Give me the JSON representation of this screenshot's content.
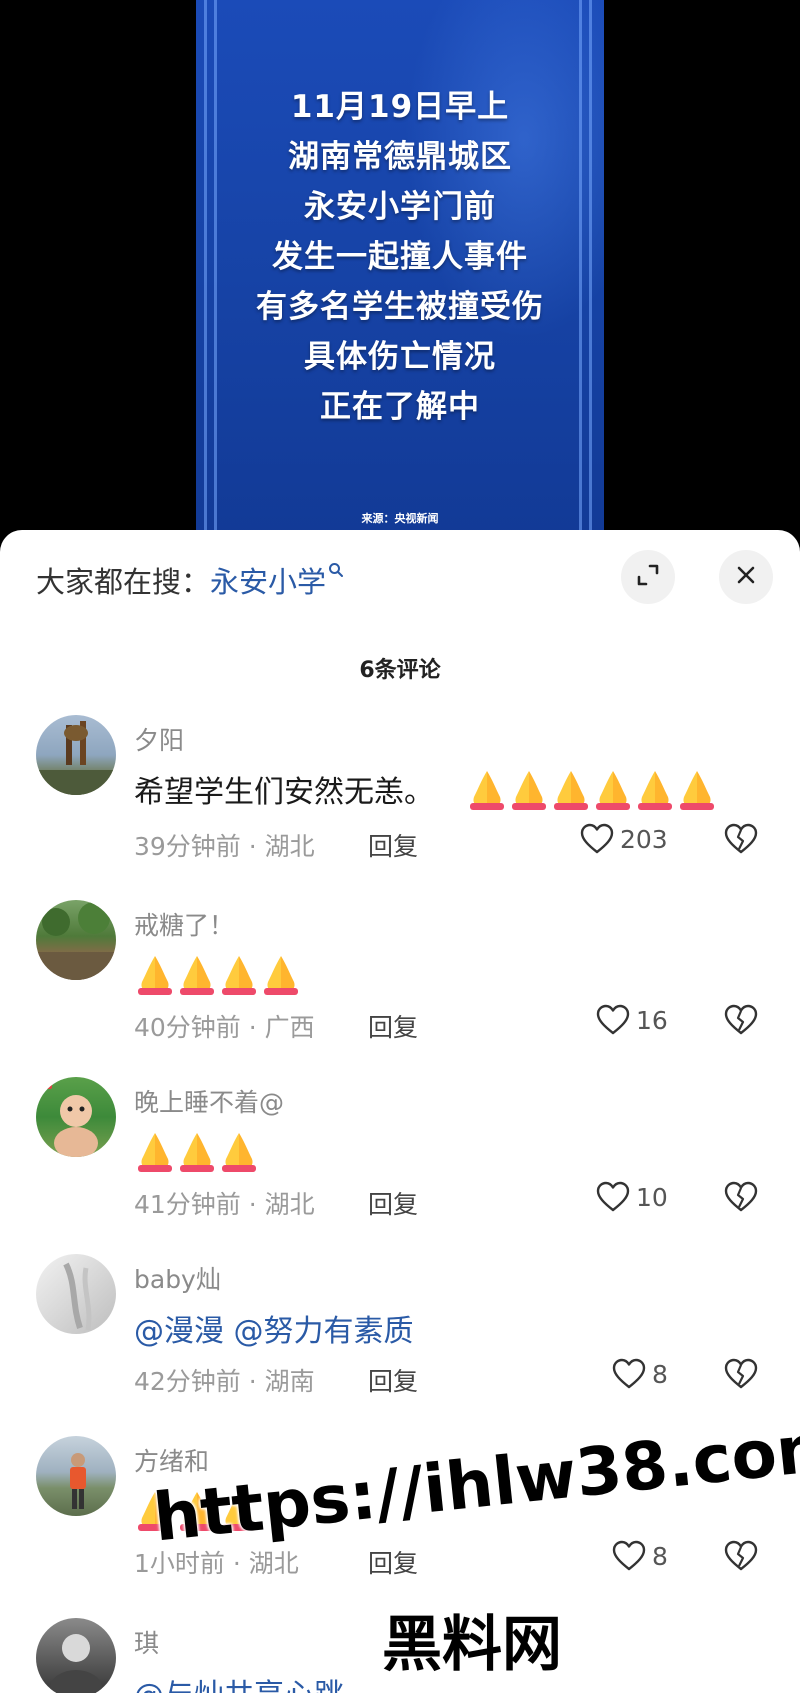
{
  "video": {
    "headline_lines": [
      "11月19日早上",
      "湖南常德鼎城区",
      "永安小学门前",
      "发生一起撞人事件",
      "有多名学生被撞受伤",
      "具体伤亡情况",
      "正在了解中"
    ],
    "source": "来源：央视新闻",
    "colors": {
      "bg": "#1744a8",
      "text": "#ffffff"
    }
  },
  "sheet": {
    "search_label": "大家都在搜：",
    "search_term": "永安小学",
    "search_icon": "search-icon",
    "expand_icon": "expand-icon",
    "close_icon": "close-icon",
    "comment_count": "6条评论"
  },
  "comments": [
    {
      "user": "夕阳",
      "text": "希望学生们安然无恙。",
      "pray_count": 6,
      "time": "39分钟前 · 湖北",
      "reply": "回复",
      "likes": "203"
    },
    {
      "user": "戒糖了！",
      "text": "",
      "pray_count": 4,
      "time": "40分钟前 · 广西",
      "reply": "回复",
      "likes": "16"
    },
    {
      "user": "晚上睡不着@",
      "text": "",
      "pray_count": 3,
      "time": "41分钟前 · 湖北",
      "reply": "回复",
      "likes": "10"
    },
    {
      "user": "baby灿",
      "text": "@漫漫 @努力有素质",
      "pray_count": 0,
      "time": "42分钟前 · 湖南",
      "reply": "回复",
      "likes": "8"
    },
    {
      "user": "方绪和",
      "text": "",
      "pray_count": 3,
      "time": "1小时前 · 湖北",
      "reply": "回复",
      "likes": "8"
    },
    {
      "user": "琪",
      "text": "@与灿共享心跳",
      "pray_count": 0,
      "time": "",
      "reply": "",
      "likes": ""
    }
  ],
  "watermark": {
    "line1": "https://ihlw38.com",
    "line2": "黑料网"
  },
  "colors": {
    "mention": "#2a5aa6",
    "meta": "#9a9a9a",
    "sheet_bg": "#ffffff"
  }
}
